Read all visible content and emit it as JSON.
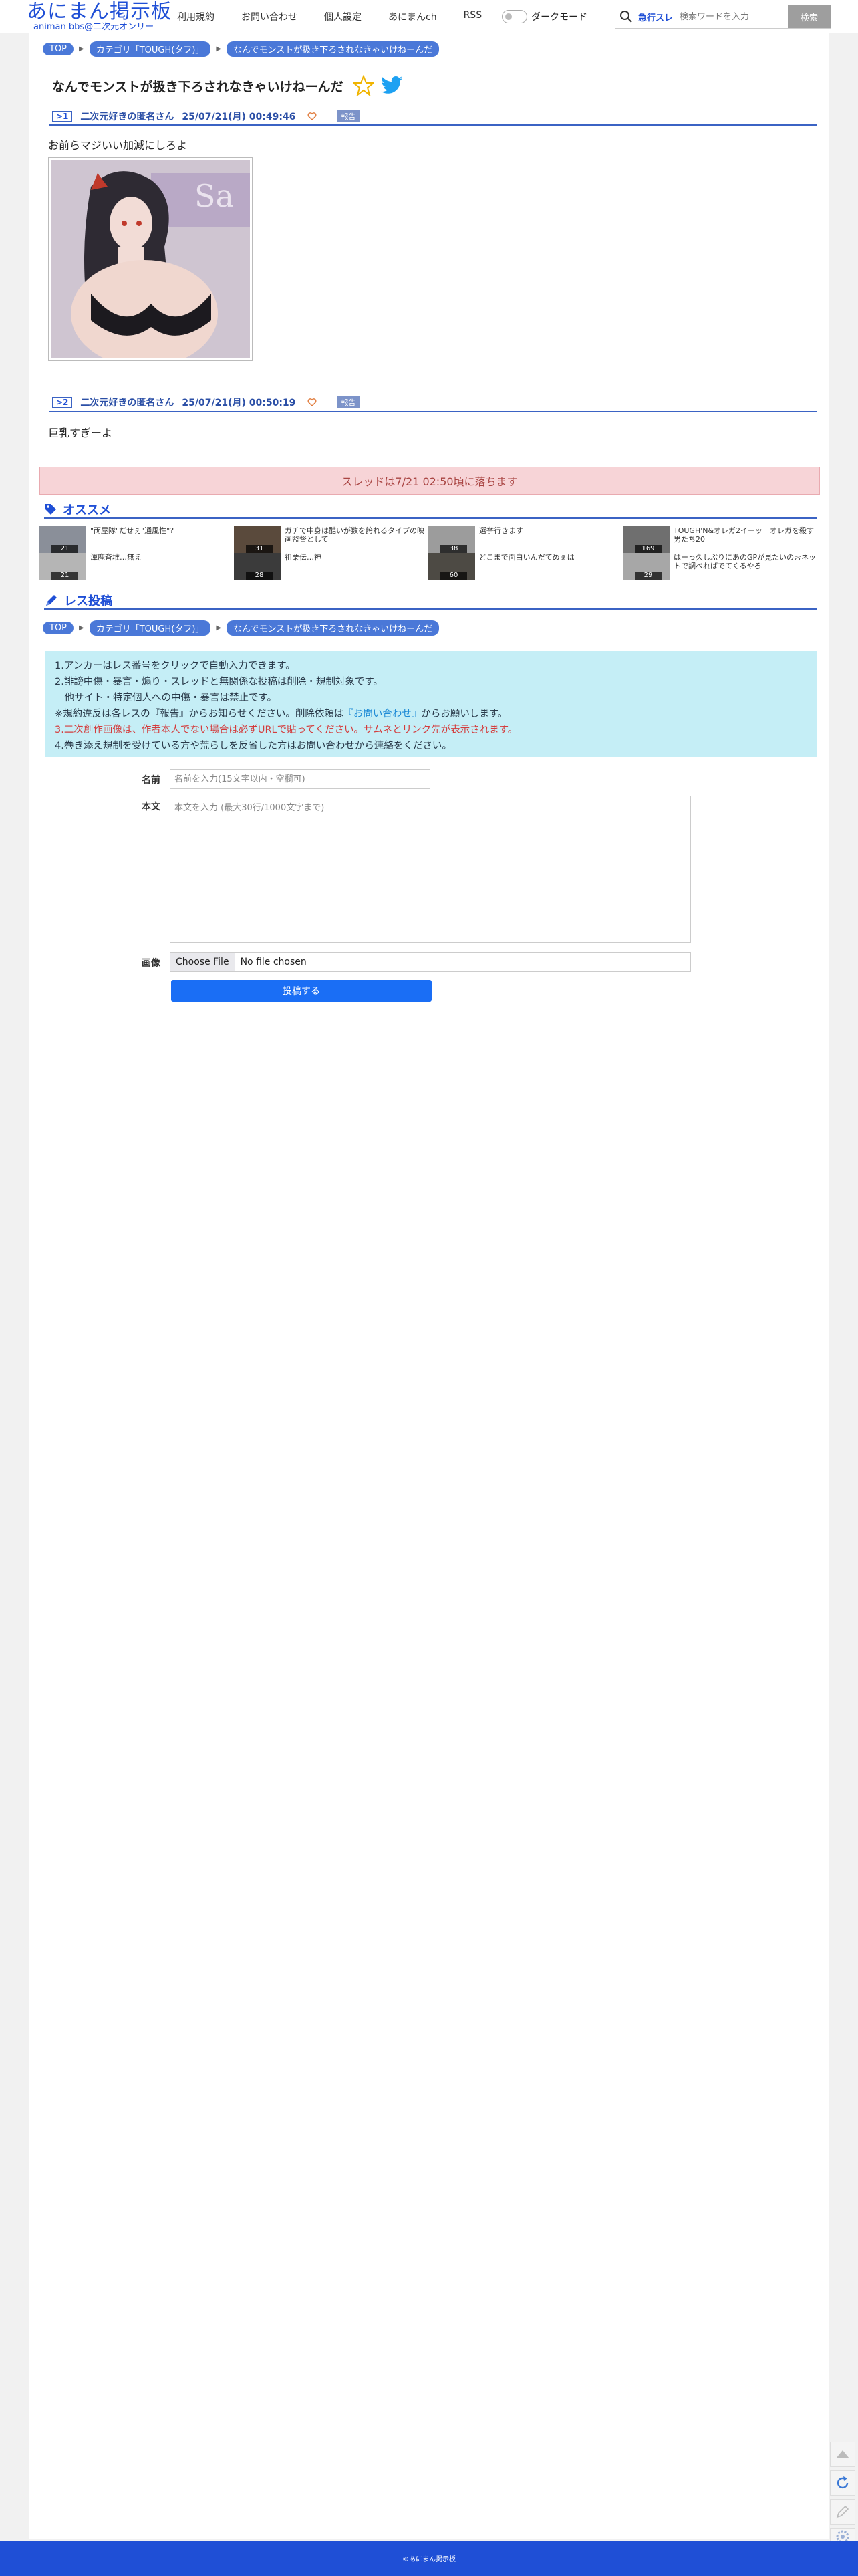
{
  "header": {
    "logo_main": "あにまん掲示板",
    "logo_sub": "animan bbs@二次元オンリー",
    "nav": [
      "利用規約",
      "お問い合わせ",
      "個人設定",
      "あにまんch",
      "RSS"
    ],
    "dark_mode_label": "ダークモード",
    "search": {
      "trend_label": "急行スレ",
      "placeholder": "検索ワードを入力",
      "button_label": "検索"
    }
  },
  "breadcrumb": [
    "TOP",
    "カテゴリ「TOUGH(タフ)」",
    "なんでモンストが扱き下ろされなきゃいけねーんだ"
  ],
  "thread": {
    "title": "なんでモンストが扱き下ろされなきゃいけねーんだ",
    "posts": [
      {
        "no": ">1",
        "name": "二次元好きの匿名さん",
        "date": "25/07/21(月) 00:49:46",
        "report": "報告",
        "body": "お前らマジいい加減にしろよ"
      },
      {
        "no": ">2",
        "name": "二次元好きの匿名さん",
        "date": "25/07/21(月) 00:50:19",
        "report": "報告",
        "body": "巨乳すぎーよ"
      }
    ],
    "drop_notice": "スレッドは7/21 02:50頃に落ちます"
  },
  "recommend": {
    "heading": "オススメ",
    "items": [
      {
        "title": "\"両屋隊\"だせぇ\"通風性\"?",
        "count": "21"
      },
      {
        "title": "ガチで中身は酷いが数を誇れるタイプの映画監督として",
        "count": "31"
      },
      {
        "title": "選挙行きます",
        "count": "38"
      },
      {
        "title": "TOUGH'N&オレガ2イーッ　オレガを殺す男たち20",
        "count": "169"
      },
      {
        "title": "渾鹿斉堆…無え",
        "count": "21"
      },
      {
        "title": "祖栗伝…神",
        "count": "28"
      },
      {
        "title": "どこまで面白いんだてめぇは",
        "count": "60"
      },
      {
        "title": "はーっ久しぶりにあのGPが見たいのぉネットで調べればでてくるやろ",
        "count": "29"
      }
    ]
  },
  "reply": {
    "heading": "レス投稿",
    "rules": [
      "1.アンカーはレス番号をクリックで自動入力できます。",
      "2.誹謗中傷・暴言・煽り・スレッドと無関係な投稿は削除・規制対象です。",
      "　他サイト・特定個人への中傷・暴言は禁止です。",
      "※規約違反は各レスの『報告』からお知らせください。削除依頼は",
      "『お問い合わせ』",
      "からお願いします。",
      "3.二次創作画像は、作者本人でない場合は必ずURLで貼ってください。サムネとリンク先が表示されます。",
      "4.巻き添え規制を受けている方や荒らしを反省した方はお問い合わせから連絡をください。"
    ],
    "name_label": "名前",
    "name_placeholder": "名前を入力(15文字以内・空欄可)",
    "body_label": "本文",
    "body_placeholder": "本文を入力 (最大30行/1000文字まで)",
    "image_label": "画像",
    "file_button": "Choose File",
    "file_status": "No file chosen",
    "submit_label": "投稿する"
  },
  "footer": {
    "copyright": "©あにまん掲示板"
  }
}
